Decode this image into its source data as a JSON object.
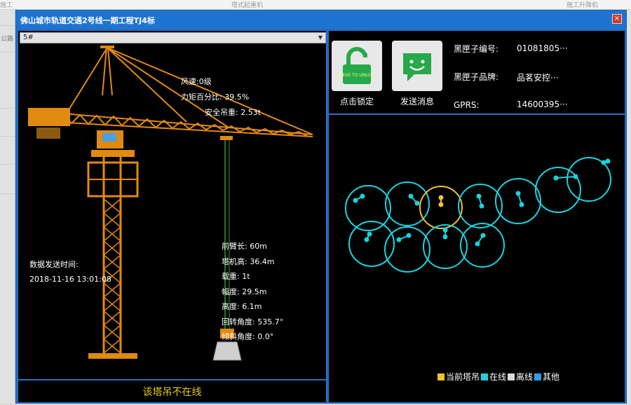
{
  "background": {
    "top_left": "施工",
    "top_center": "塔式起重机",
    "top_right": "施工升降机",
    "side_items": [
      "公路"
    ]
  },
  "dialog": {
    "title": "佛山城市轨道交通2号线一期工程TJ4标",
    "close_label": "×"
  },
  "crane_select": {
    "value": "5#"
  },
  "crane_info": {
    "wind": "风速:0级",
    "torque": "力矩百分比: 39.5%",
    "safe_load": "安全吊重: 2.53t",
    "boom_length": "前臂长: 60m",
    "tower_height": "塔机高: 36.4m",
    "load": "载重: 1t",
    "amplitude": "幅度: 29.5m",
    "height": "高度: 6.1m",
    "rotation_angle": "回转角度: 535.7°",
    "tilt_angle": "倾斜角度: 0.0°"
  },
  "send_time": {
    "label": "数据发送时间:",
    "value": "2018-11-16 13:01:08"
  },
  "status": {
    "text": "该塔吊不在线"
  },
  "actions": {
    "lock_label": "点击锁定",
    "lock_badge": "PRESS TO UNLOCK",
    "message_label": "发送消息"
  },
  "blackbox": {
    "id_key": "黑匣子编号:",
    "id_value": "01081805···",
    "brand_key": "黑匣子品牌:",
    "brand_value": "品茗安控···",
    "gprs_key": "GPRS:",
    "gprs_value": "14600395···"
  },
  "legend": {
    "current": "当前塔吊",
    "online": "在线",
    "offline": "离线",
    "other": "其他"
  },
  "colors": {
    "current": "#f2c12e",
    "online": "#19d3e0",
    "offline": "#d8d8d8",
    "other": "#2e9be8",
    "status_text": "#e8d000"
  }
}
